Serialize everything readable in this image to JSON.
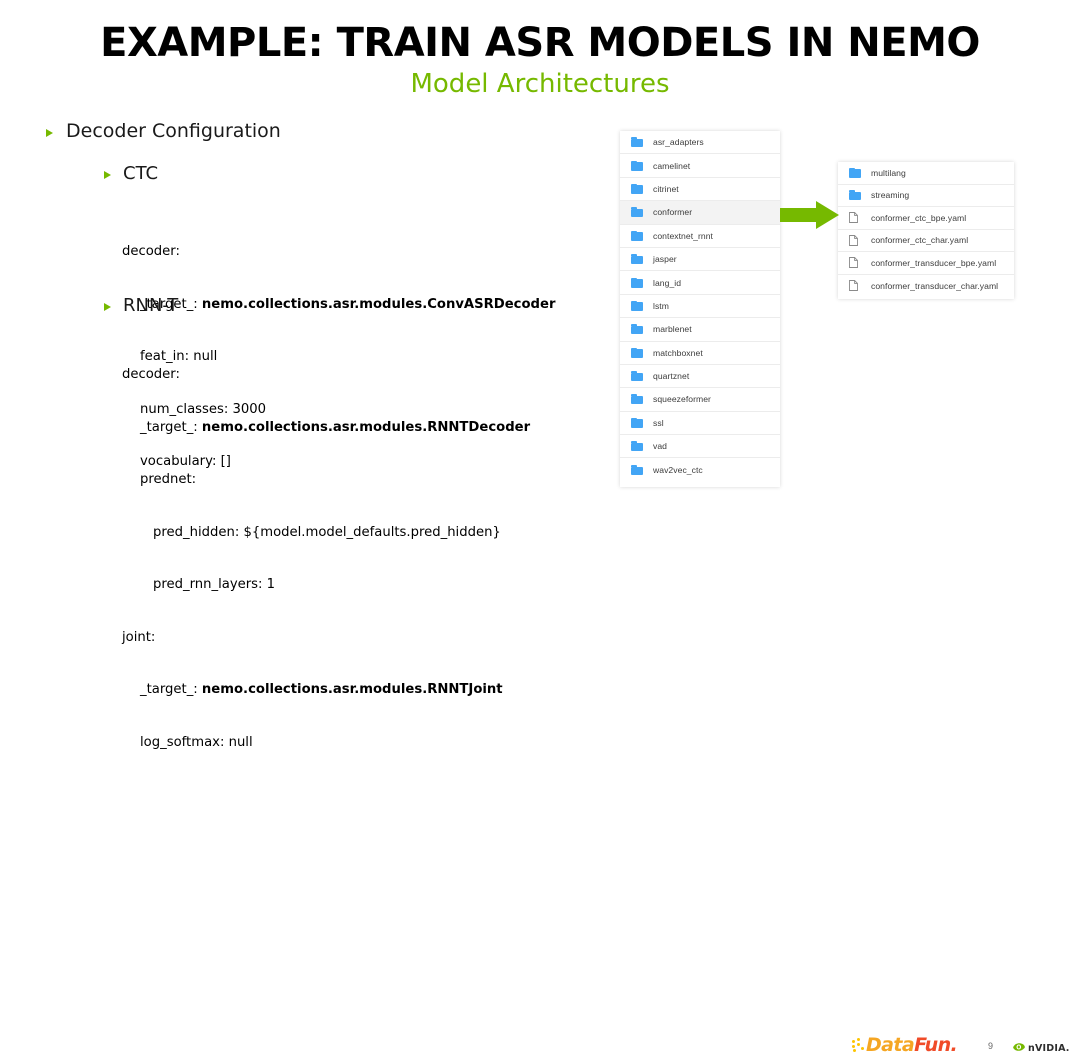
{
  "slide": {
    "title": "EXAMPLE: TRAIN ASR MODELS IN NEMO",
    "subtitle": "Model Architectures"
  },
  "bullets": {
    "level1": "Decoder Configuration",
    "ctc": "CTC",
    "rnnt": "RNN-T"
  },
  "code": {
    "ctc": {
      "l1": "decoder:",
      "l2_key": "_target_: ",
      "l2_val": "nemo.collections.asr.modules.ConvASRDecoder",
      "l3": "feat_in: null",
      "l4": "num_classes: 3000",
      "l5": "vocabulary: []"
    },
    "rnnt": {
      "l1": "decoder:",
      "l2_key": "_target_: ",
      "l2_val": "nemo.collections.asr.modules.RNNTDecoder",
      "l3": "prednet:",
      "l4": "pred_hidden: ${model.model_defaults.pred_hidden}",
      "l5": "pred_rnn_layers: 1",
      "l6": "joint:",
      "l7_key": "_target_: ",
      "l7_val": "nemo.collections.asr.modules.RNNTJoint",
      "l8": "log_softmax: null"
    }
  },
  "file_browser": {
    "left_panel": {
      "items": [
        {
          "name": "asr_adapters",
          "type": "folder",
          "selected": false
        },
        {
          "name": "camelinet",
          "type": "folder",
          "selected": false
        },
        {
          "name": "citrinet",
          "type": "folder",
          "selected": false
        },
        {
          "name": "conformer",
          "type": "folder",
          "selected": true
        },
        {
          "name": "contextnet_rnnt",
          "type": "folder",
          "selected": false
        },
        {
          "name": "jasper",
          "type": "folder",
          "selected": false
        },
        {
          "name": "lang_id",
          "type": "folder",
          "selected": false
        },
        {
          "name": "lstm",
          "type": "folder",
          "selected": false
        },
        {
          "name": "marblenet",
          "type": "folder",
          "selected": false
        },
        {
          "name": "matchboxnet",
          "type": "folder",
          "selected": false
        },
        {
          "name": "quartznet",
          "type": "folder",
          "selected": false
        },
        {
          "name": "squeezeformer",
          "type": "folder",
          "selected": false
        },
        {
          "name": "ssl",
          "type": "folder",
          "selected": false
        },
        {
          "name": "vad",
          "type": "folder",
          "selected": false
        },
        {
          "name": "wav2vec_ctc",
          "type": "folder",
          "selected": false
        }
      ]
    },
    "right_panel": {
      "items": [
        {
          "name": "multilang",
          "type": "folder",
          "selected": false
        },
        {
          "name": "streaming",
          "type": "folder",
          "selected": false
        },
        {
          "name": "conformer_ctc_bpe.yaml",
          "type": "file",
          "selected": false
        },
        {
          "name": "conformer_ctc_char.yaml",
          "type": "file",
          "selected": false
        },
        {
          "name": "conformer_transducer_bpe.yaml",
          "type": "file",
          "selected": false
        },
        {
          "name": "conformer_transducer_char.yaml",
          "type": "file",
          "selected": false
        }
      ]
    },
    "arrow_icon": "green-right-arrow-icon"
  },
  "footer": {
    "datafun_data": "Data",
    "datafun_fun": "Fun.",
    "page_number": "9",
    "nvidia_text": "nVIDIA."
  },
  "colors": {
    "nvidia_green": "#76b900",
    "folder_blue": "#42a5f5",
    "datafun_orange": "#f5a623",
    "datafun_red": "#f04b28"
  }
}
